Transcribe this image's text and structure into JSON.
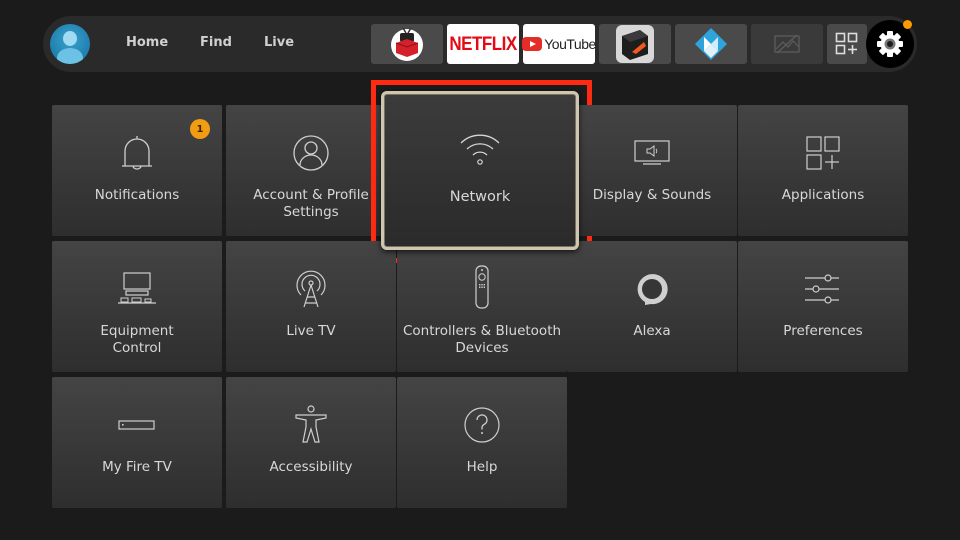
{
  "nav": {
    "links": [
      "Home",
      "Find",
      "Live"
    ],
    "apps": [
      {
        "name": "RedBox TV",
        "icon": "redbox-tv-icon"
      },
      {
        "name": "Netflix",
        "label": "NETFLIX",
        "icon": "netflix-logo"
      },
      {
        "name": "YouTube",
        "label": "YouTube",
        "icon": "youtube-logo"
      },
      {
        "name": "Downloader",
        "icon": "downloader-icon"
      },
      {
        "name": "Kodi",
        "icon": "kodi-icon"
      },
      {
        "name": "Placeholder App",
        "icon": "image-placeholder-icon"
      },
      {
        "name": "All Apps",
        "icon": "apps-grid-plus-icon"
      }
    ],
    "settings_icon": "gear-icon",
    "accent": "#ff9900"
  },
  "settings": {
    "tiles": [
      {
        "label": "Notifications",
        "icon": "bell-icon",
        "badge": "1"
      },
      {
        "label": "Account & Profile Settings",
        "icon": "profile-icon"
      },
      {
        "label": "Network",
        "icon": "wifi-icon",
        "focused": true
      },
      {
        "label": "Display & Sounds",
        "icon": "tv-speaker-icon"
      },
      {
        "label": "Applications",
        "icon": "apps-grid-plus-icon"
      },
      {
        "label": "Equipment Control",
        "icon": "equipment-icon"
      },
      {
        "label": "Live TV",
        "icon": "antenna-icon"
      },
      {
        "label": "Controllers & Bluetooth Devices",
        "icon": "remote-icon"
      },
      {
        "label": "Alexa",
        "icon": "alexa-icon"
      },
      {
        "label": "Preferences",
        "icon": "sliders-icon"
      },
      {
        "label": "My Fire TV",
        "icon": "fire-tv-device-icon"
      },
      {
        "label": "Accessibility",
        "icon": "accessibility-icon"
      },
      {
        "label": "Help",
        "icon": "help-icon"
      }
    ],
    "highlight_color": "#ff2a12"
  }
}
